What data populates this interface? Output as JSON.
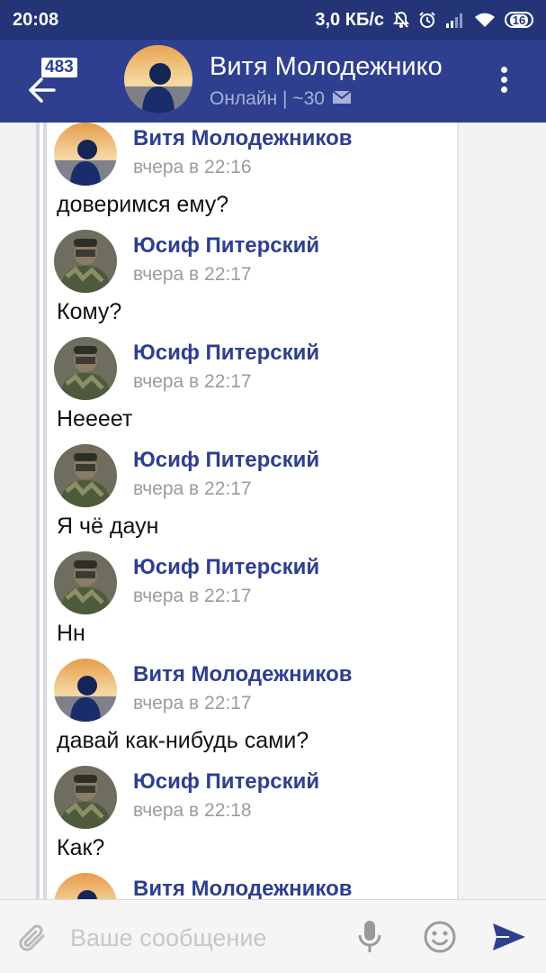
{
  "status_bar": {
    "time": "20:08",
    "net_speed": "3,0 КБ/с",
    "battery": "16"
  },
  "header": {
    "unread_count": "483",
    "title": "Витя Молодежнико",
    "status": "Онлайн | ~30"
  },
  "messages": [
    {
      "author": "Витя Молодежников",
      "time": "вчера в 22:16",
      "text": "доверимся ему?",
      "avatar": "vitya"
    },
    {
      "author": "Юсиф Питерский",
      "time": "вчера в 22:17",
      "text": "Кому?",
      "avatar": "yusif"
    },
    {
      "author": "Юсиф Питерский",
      "time": "вчера в 22:17",
      "text": "Нееeет",
      "avatar": "yusif"
    },
    {
      "author": "Юсиф Питерский",
      "time": "вчера в 22:17",
      "text": "Я чё даун",
      "avatar": "yusif"
    },
    {
      "author": "Юсиф Питерский",
      "time": "вчера в 22:17",
      "text": "Нн",
      "avatar": "yusif"
    },
    {
      "author": "Витя Молодежников",
      "time": "вчера в 22:17",
      "text": "давай как-нибудь сами?",
      "avatar": "vitya"
    },
    {
      "author": "Юсиф Питерский",
      "time": "вчера в 22:18",
      "text": "Как?",
      "avatar": "yusif"
    },
    {
      "author": "Витя Молодежников",
      "time": "",
      "text": "",
      "avatar": "vitya"
    }
  ],
  "composer": {
    "placeholder": "Ваше сообщение"
  },
  "colors": {
    "status_bar": "#243577",
    "toolbar": "#2e3f8f",
    "author": "#2e3f8f",
    "timestamp": "#9b9b9b"
  }
}
